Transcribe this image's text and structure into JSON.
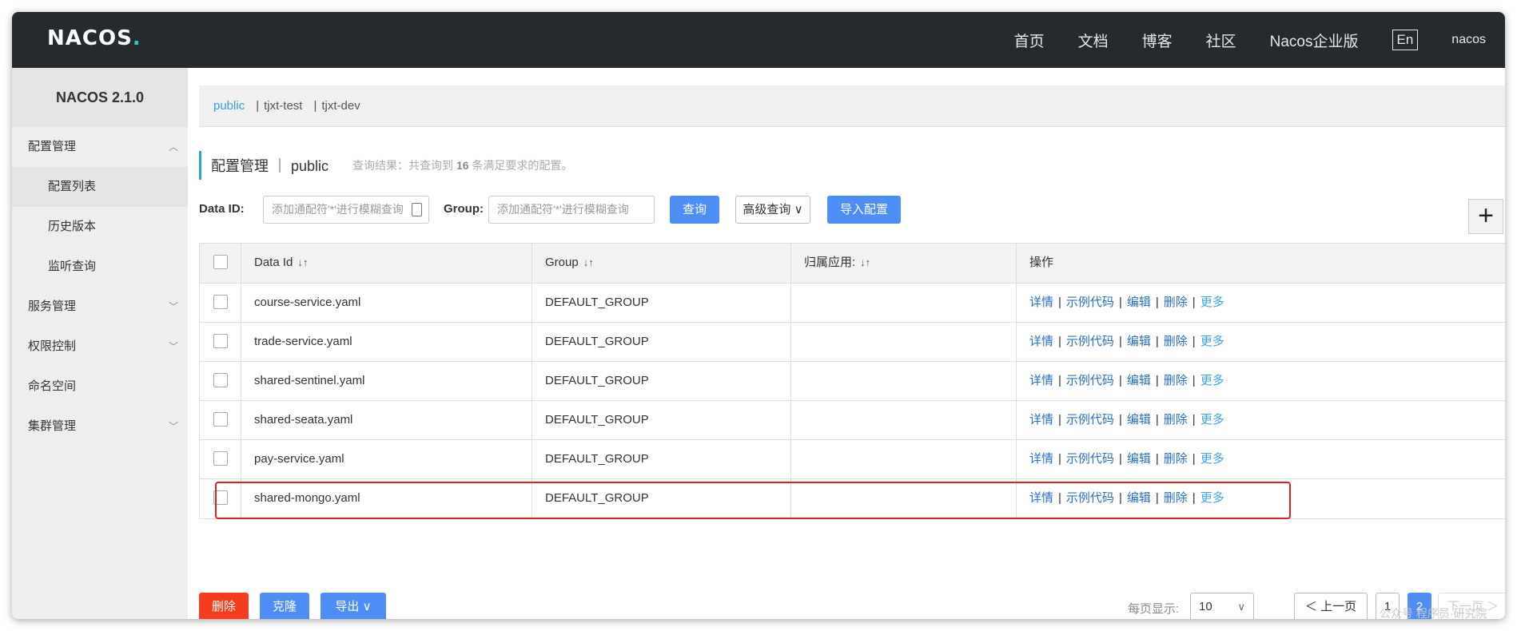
{
  "header": {
    "logo_main": "NACOS",
    "logo_dot": ".",
    "nav": [
      "首页",
      "文档",
      "博客",
      "社区",
      "Nacos企业版"
    ],
    "lang": "En",
    "user": "nacos"
  },
  "sidebar": {
    "version": "NACOS 2.1.0",
    "config_mgmt": "配置管理",
    "config_list": "配置列表",
    "history": "历史版本",
    "listener": "监听查询",
    "service_mgmt": "服务管理",
    "auth": "权限控制",
    "namespace": "命名空间",
    "cluster": "集群管理"
  },
  "namespaces": [
    "public",
    "tjxt-test",
    "tjxt-dev"
  ],
  "namespace_sep": "|",
  "title": "配置管理 ｜ public",
  "result_prefix": "查询结果：共查询到",
  "result_count": "16",
  "result_suffix": "条满足要求的配置。",
  "filters": {
    "dataid_label": "Data ID:",
    "dataid_placeholder": "添加通配符'*'进行模糊查询",
    "group_label": "Group:",
    "group_placeholder": "添加通配符'*'进行模糊查询",
    "query": "查询",
    "advanced": "高级查询 ∨",
    "import": "导入配置",
    "plus": "+"
  },
  "table": {
    "headers": {
      "dataid": "Data Id",
      "group": "Group",
      "app": "归属应用:",
      "ops": "操作"
    },
    "sort_icon": "↓↑",
    "rows": [
      {
        "dataid": "course-service.yaml",
        "group": "DEFAULT_GROUP",
        "app": ""
      },
      {
        "dataid": "trade-service.yaml",
        "group": "DEFAULT_GROUP",
        "app": ""
      },
      {
        "dataid": "shared-sentinel.yaml",
        "group": "DEFAULT_GROUP",
        "app": ""
      },
      {
        "dataid": "shared-seata.yaml",
        "group": "DEFAULT_GROUP",
        "app": ""
      },
      {
        "dataid": "pay-service.yaml",
        "group": "DEFAULT_GROUP",
        "app": ""
      },
      {
        "dataid": "shared-mongo.yaml",
        "group": "DEFAULT_GROUP",
        "app": ""
      }
    ],
    "ops": {
      "detail": "详情",
      "sample": "示例代码",
      "edit": "编辑",
      "delete": "删除",
      "more": "更多",
      "sep": "|"
    }
  },
  "bottom": {
    "delete": "删除",
    "clone": "克隆",
    "export": "导出 ∨",
    "page_size_label": "每页显示:",
    "page_size": "10",
    "prev": "＜ 上一页",
    "pages": [
      "1",
      "2"
    ],
    "next": "下一页 ＞"
  },
  "watermark": "公众号 程序员·研究院",
  "colors": {
    "topbar": "#252a2f",
    "accent": "#2ea1d9",
    "primary_button": "#4e8ef7",
    "danger_button": "#f53d1e",
    "highlight_box": "#e02020"
  }
}
